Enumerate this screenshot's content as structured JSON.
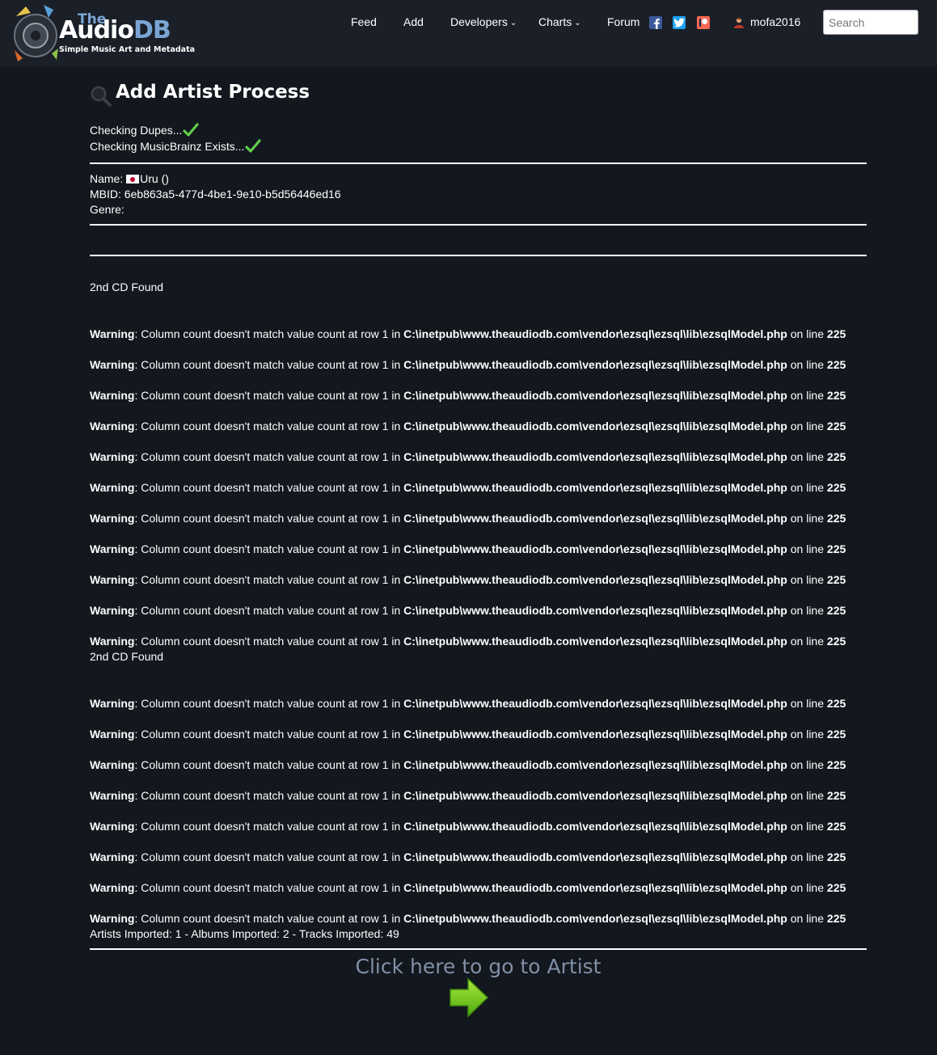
{
  "header": {
    "logo_the": "The",
    "logo_audio": "Audio",
    "logo_db": "DB",
    "logo_tagline": "Simple Music Art and Metadata",
    "nav": {
      "feed": "Feed",
      "add": "Add",
      "developers": "Developers",
      "charts": "Charts",
      "forum": "Forum"
    },
    "username": "mofa2016",
    "search_placeholder": "Search"
  },
  "page": {
    "title": "Add Artist Process",
    "checks": [
      "Checking Dupes...",
      "Checking MusicBrainz Exists..."
    ],
    "artist": {
      "name_label": "Name:",
      "name_value": "Uru ()",
      "mbid_label": "MBID:",
      "mbid_value": "6eb863a5-477d-4be1-9e10-b5d56446ed16",
      "genre_label": "Genre:",
      "genre_value": ""
    },
    "cd_found_1": "2nd CD Found",
    "cd_found_2": "2nd CD Found",
    "warning": {
      "label": "Warning",
      "message": ": Column count doesn't match value count at row 1 in ",
      "path": "C:\\inetpub\\www.theaudiodb.com\\vendor\\ezsql\\ezsql\\lib\\ezsqlModel.php",
      "on_line": " on line ",
      "line": "225"
    },
    "summary": "Artists Imported: 1 - Albums Imported: 2 - Tracks Imported: 49",
    "go_link": "Click here to go to Artist"
  },
  "colors": {
    "background": "#13171e",
    "header_bg": "#1a1f28",
    "logo_blue": "#7aa6d4",
    "link_grey": "#7f8fa5",
    "check_green": "#5fcf4a",
    "arrow_green": "#7ad12a"
  },
  "icons": [
    "logo-disc-icon",
    "facebook-icon",
    "twitter-icon",
    "patreon-icon",
    "user-icon",
    "magnifier-icon",
    "checkmark-icon",
    "japan-flag-icon",
    "right-arrow-icon"
  ]
}
